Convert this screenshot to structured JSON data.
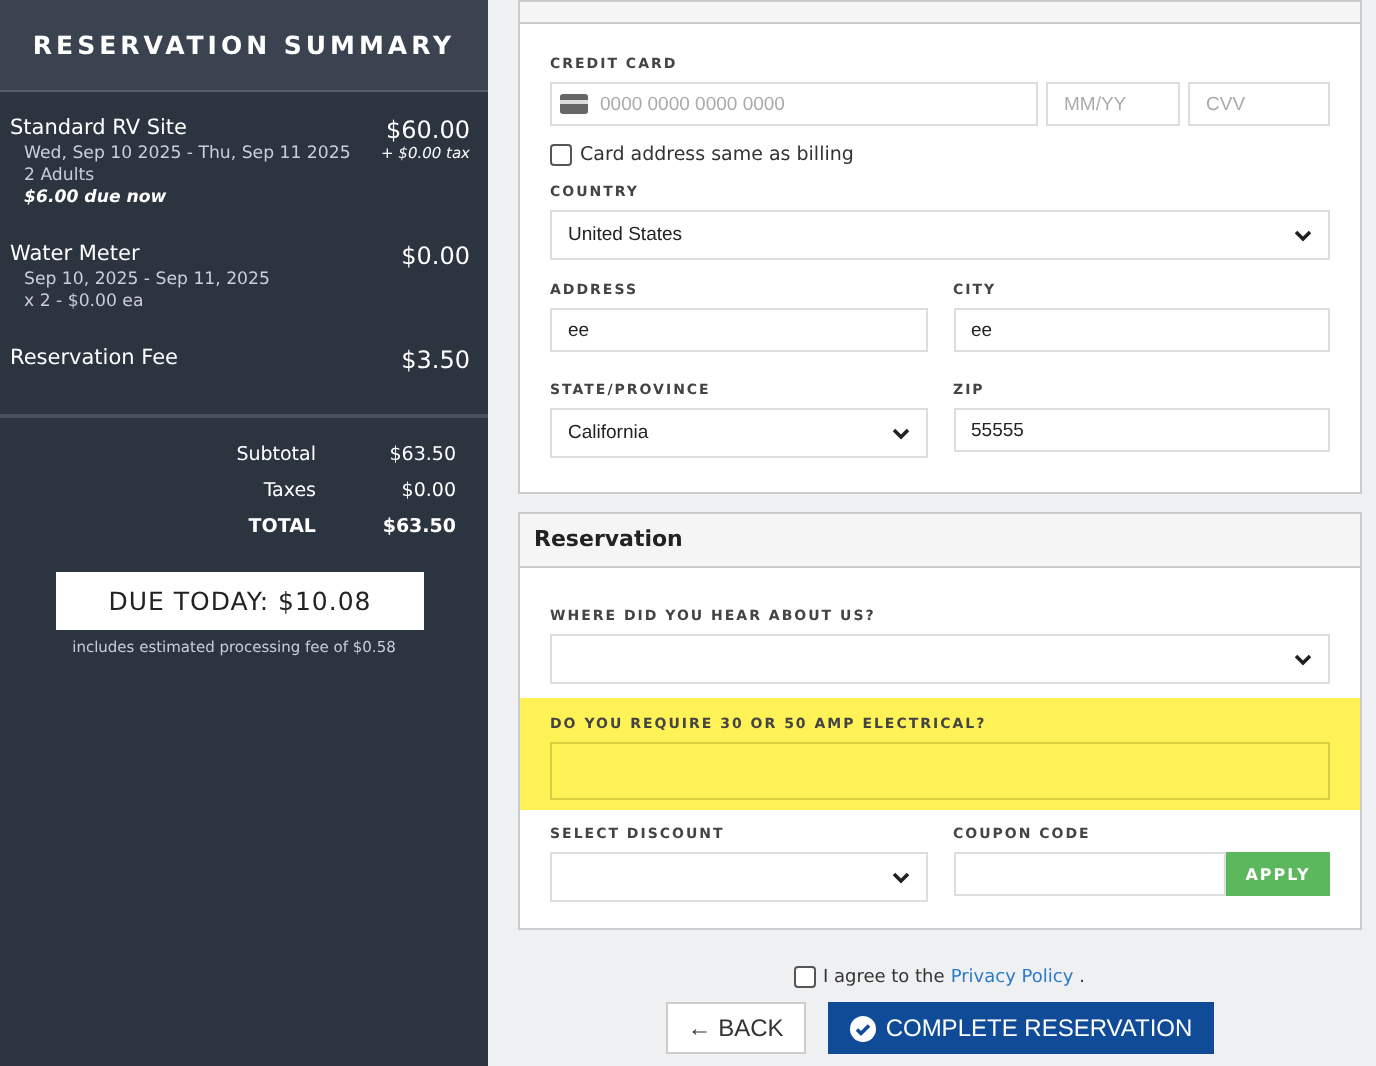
{
  "summary": {
    "title": "RESERVATION SUMMARY",
    "items": [
      {
        "name": "Standard RV Site",
        "price": "$60.00",
        "tax": "+ $0.00 tax",
        "details": [
          "Wed, Sep 10 2025 - Thu, Sep 11 2025",
          "2 Adults"
        ],
        "due": "$6.00 due now"
      },
      {
        "name": "Water Meter",
        "price": "$0.00",
        "details": [
          "Sep 10, 2025 - Sep 11, 2025",
          "x 2 - $0.00 ea"
        ]
      },
      {
        "name": "Reservation Fee",
        "price": "$3.50"
      }
    ],
    "totals": [
      {
        "label": "Subtotal",
        "value": "$63.50",
        "bold": false
      },
      {
        "label": "Taxes",
        "value": "$0.00",
        "bold": false
      },
      {
        "label": "TOTAL",
        "value": "$63.50",
        "bold": true
      }
    ],
    "due_today": "DUE TODAY: $10.08",
    "fee_note": "includes estimated processing fee of $0.58"
  },
  "payment": {
    "card_label": "CREDIT CARD",
    "card_placeholder": "0000 0000 0000 0000",
    "expiry_placeholder": "MM/YY",
    "cvv_placeholder": "CVV",
    "same_address": {
      "label": "Card address same as billing",
      "checked": false
    },
    "country_label": "COUNTRY",
    "country": "United States",
    "address_label": "ADDRESS",
    "address": "ee",
    "city_label": "CITY",
    "city": "ee",
    "state_label": "STATE/PROVINCE",
    "state": "California",
    "zip_label": "ZIP",
    "zip": "55555"
  },
  "reservation": {
    "title": "Reservation",
    "hear_label": "WHERE DID YOU HEAR ABOUT US?",
    "electrical": {
      "label": "DO YOU REQUIRE 30 OR 50 AMP ELECTRICAL?",
      "highlighted": true
    },
    "discount_label": "SELECT DISCOUNT",
    "coupon_label": "COUPON CODE",
    "apply": "APPLY"
  },
  "agree": {
    "text": "I agree to the",
    "link": "Privacy Policy",
    "end": ".",
    "checked": false
  },
  "buttons": {
    "back": "← BACK",
    "complete": "COMPLETE RESERVATION"
  }
}
